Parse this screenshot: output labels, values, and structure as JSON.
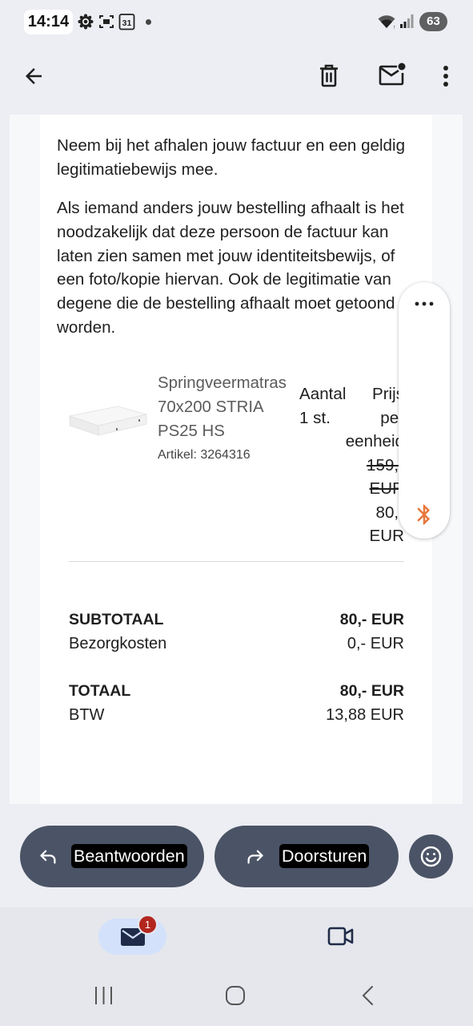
{
  "status_bar": {
    "time": "14:14",
    "calendar_day": "31",
    "battery_level": "63",
    "icons": [
      "sync-icon",
      "screenshot-icon",
      "calendar-icon",
      "notification-dot-icon",
      "wifi-icon",
      "signal-icon",
      "battery-icon"
    ]
  },
  "app_bar": {
    "icons": [
      "arrow-back-icon",
      "trash-icon",
      "mail-unread-icon",
      "more-vert-icon"
    ]
  },
  "email": {
    "paragraph_1": [
      "Neem bij het afhalen jouw factuur en een geldig",
      "legitimatiebewijs mee."
    ],
    "paragraph_2": [
      "Als iemand anders jouw bestelling afhaalt is het",
      "noodzakelijk dat deze persoon de factuur kan",
      "laten zien samen met jouw identiteitsbewijs, of",
      "een foto/kopie hiervan. Ook de legitimatie van",
      "degene die de bestelling afhaalt moet getoond",
      "worden."
    ],
    "product": {
      "image": "mattress-image",
      "name_lines": [
        "Springveermatras",
        "70x200 STRIA",
        "PS25 HS"
      ],
      "article": "Artikel: 3264316",
      "quantity_header": "Aantal",
      "quantity": "1 st.",
      "price_header_lines": [
        "Prijs",
        "per",
        "eenheid"
      ],
      "old_price_lines": [
        "159,-",
        "EUR"
      ],
      "price_lines": [
        "80,-",
        "EUR"
      ]
    },
    "totals": {
      "subtotal_label": "SUBTOTAAL",
      "subtotal_value": "80,- EUR",
      "shipping_label": "Bezorgkosten",
      "shipping_value": "0,- EUR",
      "total_label": "TOTAAL",
      "total_value": "80,- EUR",
      "vat_label": "BTW",
      "vat_value": "13,88 EUR"
    }
  },
  "floating_panel": {
    "icons": [
      "more-horiz-icon",
      "bluetooth-icon"
    ]
  },
  "actions": {
    "reply_label": "Beantwoorden",
    "forward_label": "Doorsturen",
    "emoji_icon": "emoji-reaction-icon"
  },
  "bottom_nav": {
    "items": [
      "mail-icon",
      "video-icon"
    ],
    "mail_badge": "1"
  },
  "system_nav": {
    "icons": [
      "recents-icon",
      "home-icon",
      "back-icon"
    ]
  },
  "colors": {
    "action_button": "#4b5466",
    "active_nav": "#d3e1fb",
    "badge": "#b3261e",
    "bluetooth": "#e8773a",
    "background": "#edeef3"
  }
}
